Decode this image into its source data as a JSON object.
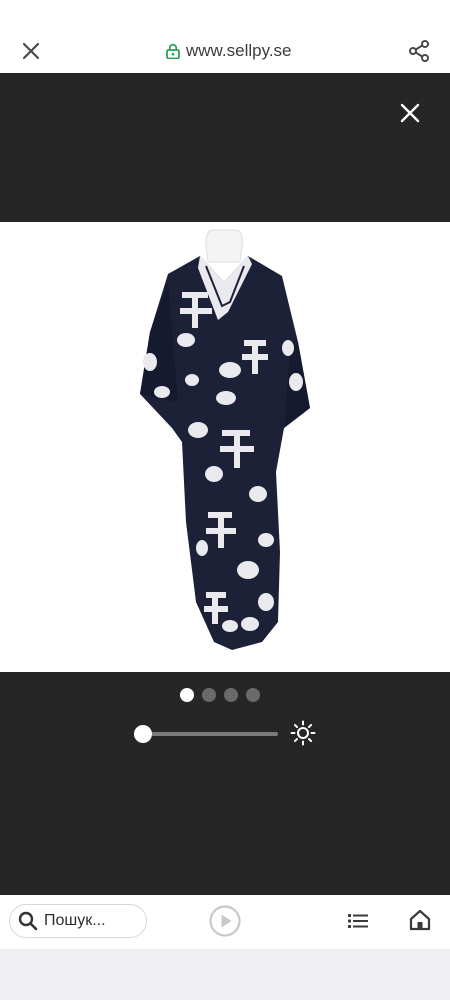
{
  "browser": {
    "url": "www.sellpy.se",
    "lock_icon": "lock-icon",
    "close_icon": "close-icon",
    "share_icon": "share-icon"
  },
  "viewer": {
    "close_icon": "close-icon",
    "image_description": "kimono-product-photo",
    "pagination": {
      "total": 4,
      "active_index": 0
    },
    "brightness": {
      "level": 0,
      "icon": "brightness-icon"
    }
  },
  "bottom_nav": {
    "search_placeholder": "Пошук...",
    "search_icon": "search-icon",
    "play_icon": "play-icon",
    "list_icon": "list-icon",
    "home_icon": "home-icon"
  },
  "colors": {
    "viewer_bg": "#262626",
    "kimono": "#1c2138",
    "pattern": "#e9e9ee",
    "lock_green": "#2e9e5a"
  }
}
